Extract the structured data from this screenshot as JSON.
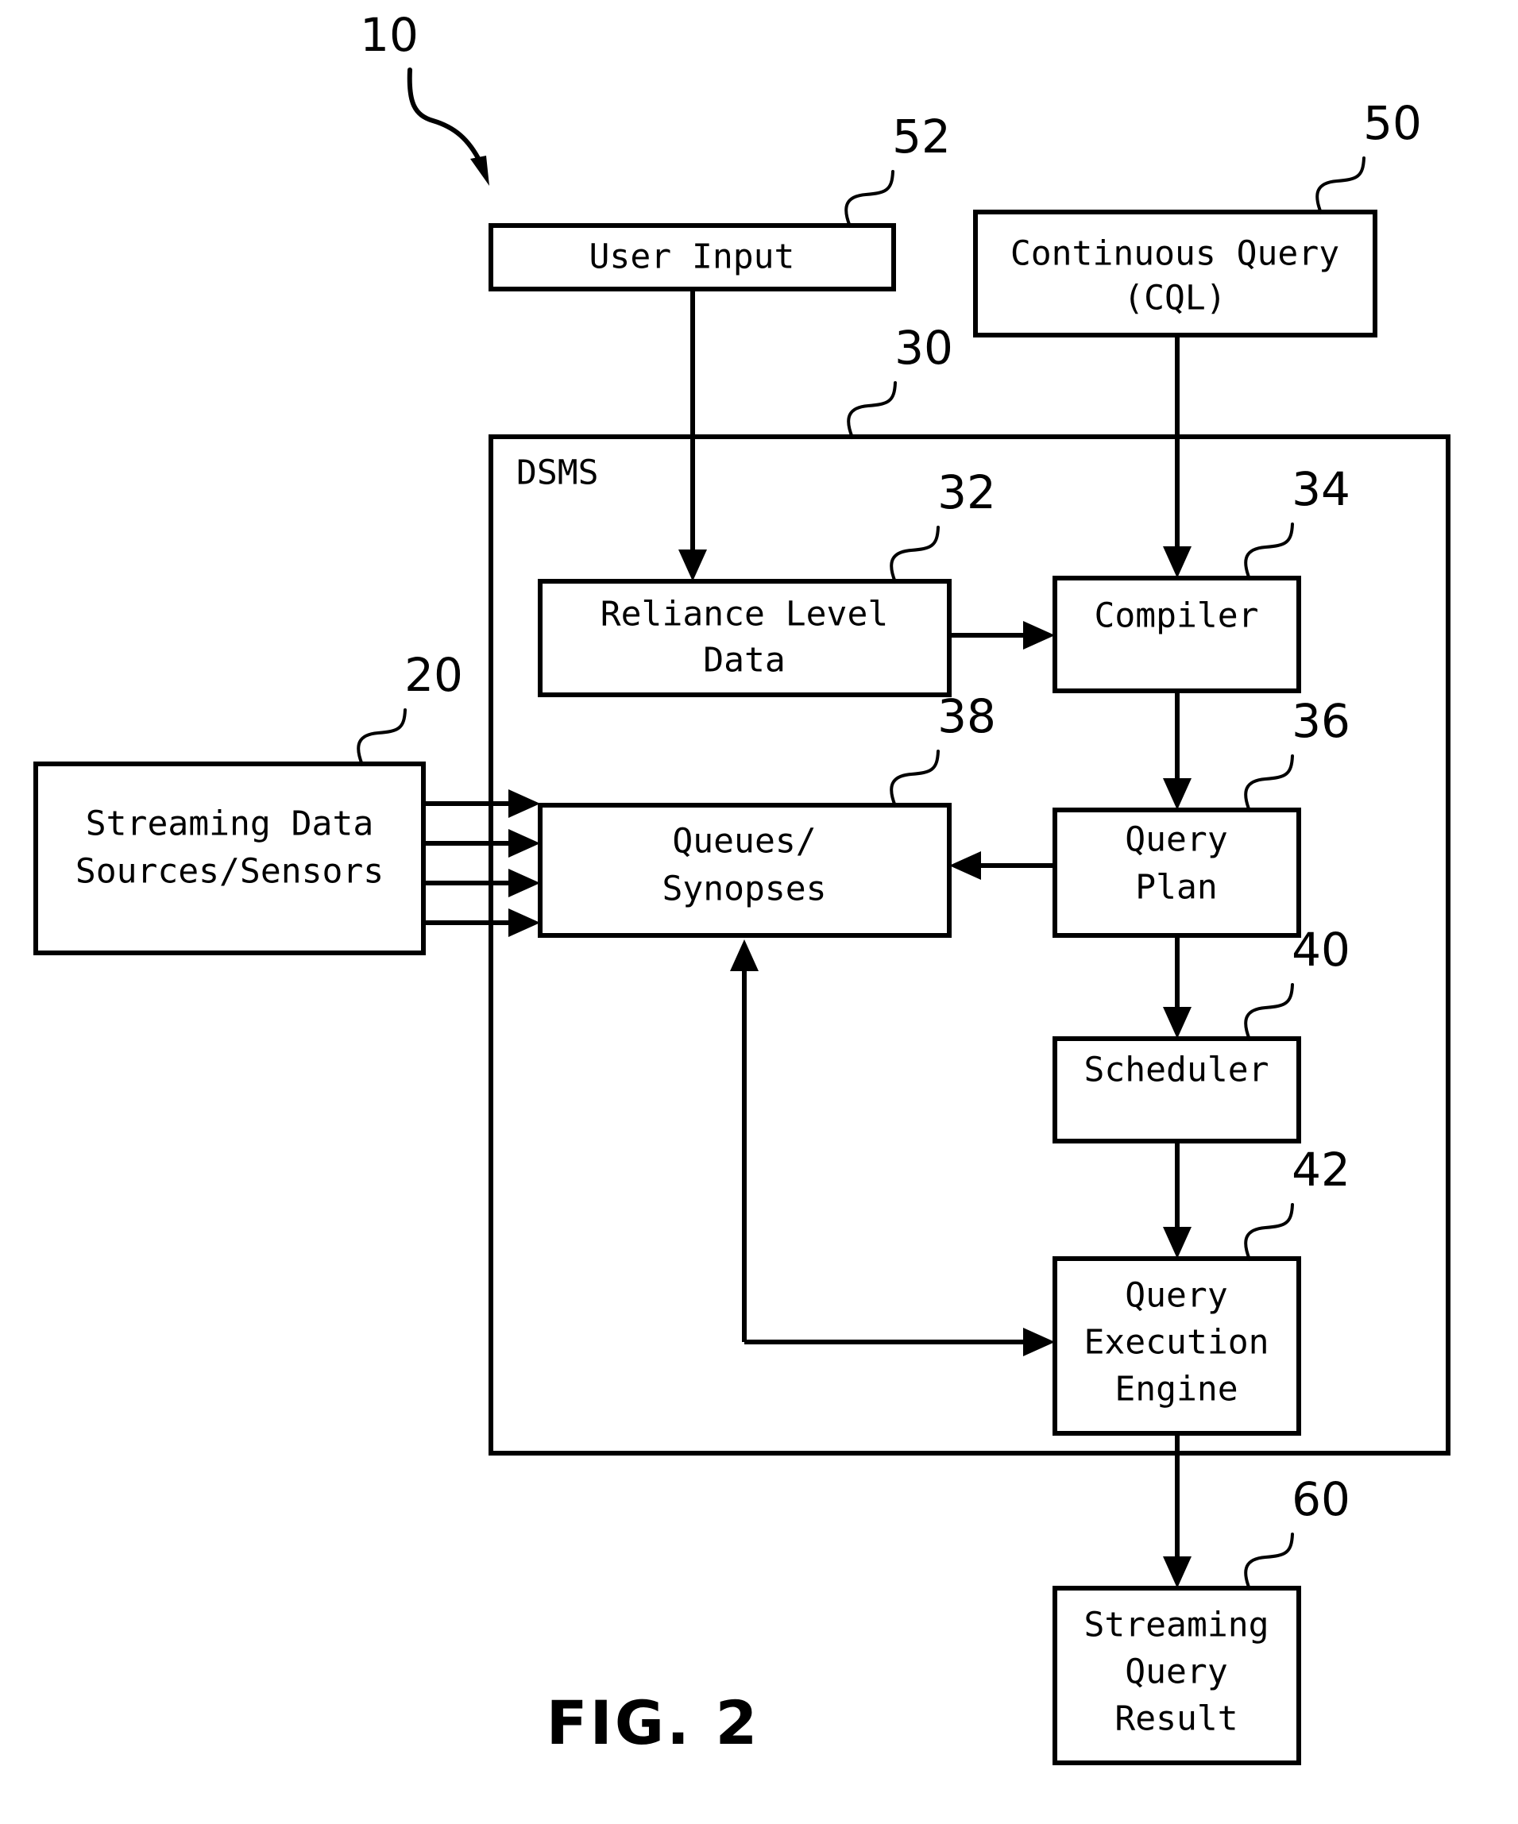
{
  "figure": {
    "caption": "FIG. 2",
    "overall_ref": "10"
  },
  "boxes": {
    "user_input": {
      "label": "User Input",
      "ref": "52"
    },
    "continuous_query": {
      "label_line1": "Continuous Query",
      "label_line2": "(CQL)",
      "ref": "50"
    },
    "dsms": {
      "label": "DSMS",
      "ref": "30"
    },
    "reliance_level_data": {
      "label_line1": "Reliance Level",
      "label_line2": "Data",
      "ref": "32"
    },
    "compiler": {
      "label": "Compiler",
      "ref": "34"
    },
    "streaming_data_sources": {
      "label_line1": "Streaming Data",
      "label_line2": "Sources/Sensors",
      "ref": "20"
    },
    "queues_synopses": {
      "label_line1": "Queues/",
      "label_line2": "Synopses",
      "ref": "38"
    },
    "query_plan": {
      "label_line1": "Query",
      "label_line2": "Plan",
      "ref": "36"
    },
    "scheduler": {
      "label": "Scheduler",
      "ref": "40"
    },
    "query_execution_engine": {
      "label_line1": "Query",
      "label_line2": "Execution",
      "label_line3": "Engine",
      "ref": "42"
    },
    "streaming_query_result": {
      "label_line1": "Streaming",
      "label_line2": "Query",
      "label_line3": "Result",
      "ref": "60"
    }
  },
  "colors": {
    "stroke": "#000000",
    "background": "#ffffff"
  }
}
